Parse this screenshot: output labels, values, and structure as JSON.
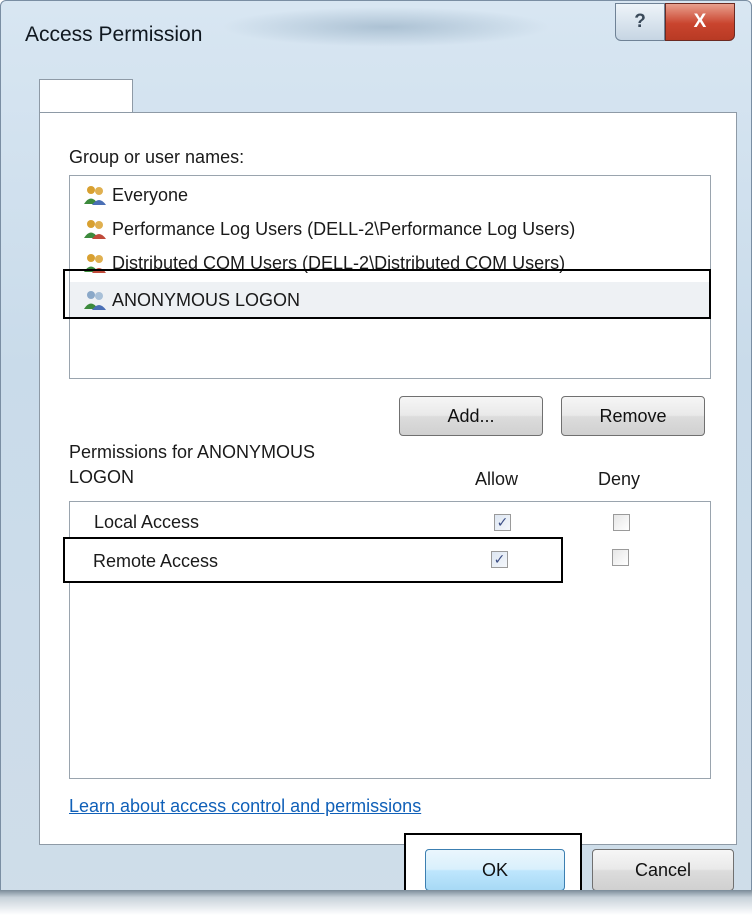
{
  "window": {
    "title": "Access Permission",
    "help_label": "?",
    "close_label": "X"
  },
  "group": {
    "label": "Group or user names:",
    "users": [
      {
        "name": "Everyone",
        "icon": "users-icon"
      },
      {
        "name": "Performance Log Users (DELL-2\\Performance Log Users)",
        "icon": "users-icon"
      },
      {
        "name": "Distributed COM Users (DELL-2\\Distributed COM Users)",
        "icon": "users-icon"
      },
      {
        "name": "ANONYMOUS LOGON",
        "icon": "users-icon",
        "selected": true
      }
    ]
  },
  "buttons": {
    "add": "Add...",
    "remove": "Remove",
    "ok": "OK",
    "cancel": "Cancel"
  },
  "permissions": {
    "label_line1": "Permissions for ANONYMOUS",
    "label_line2": "LOGON",
    "allow_header": "Allow",
    "deny_header": "Deny",
    "rows": [
      {
        "name": "Local Access",
        "allow": true,
        "deny": false
      },
      {
        "name": "Remote Access",
        "allow": true,
        "deny": false
      }
    ]
  },
  "link": {
    "text": "Learn about access control and permissions"
  },
  "colors": {
    "link": "#1060b8",
    "close_button": "#c9442e",
    "ok_button": "#bee6fd"
  }
}
